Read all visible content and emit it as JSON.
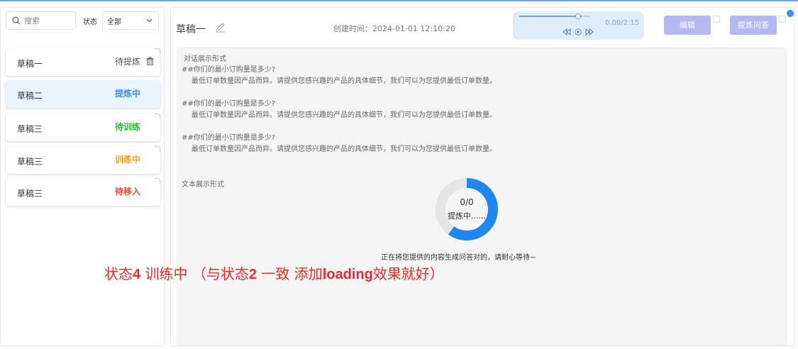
{
  "search": {
    "placeholder": "搜索"
  },
  "status_filter": {
    "label": "状态",
    "value": "全部"
  },
  "drafts": [
    {
      "name": "草稿一",
      "status": "待提炼",
      "status_color": "#555555"
    },
    {
      "name": "草稿二",
      "status": "提炼中",
      "status_color": "#3a8ee6"
    },
    {
      "name": "草稿三",
      "status": "待训练",
      "status_color": "#2eb82e"
    },
    {
      "name": "草稿三",
      "status": "训练中",
      "status_color": "#f2a31a"
    },
    {
      "name": "草稿三",
      "status": "待移入",
      "status_color": "#ee4c3c"
    }
  ],
  "header": {
    "title": "草稿一",
    "created_label": "创建时间：2024-01-01 12:10:20"
  },
  "player": {
    "time": "0.00/2:15",
    "progress": 0.88
  },
  "actions": {
    "edit_label": "编辑",
    "refine_label": "提炼问答"
  },
  "content": {
    "dialog_section_title": "对话展示形式",
    "qa_pairs": [
      {
        "q": "##你们的最小订购量是多少?",
        "a": "最低订单数量因产品而异。请提供您感兴趣的产品的具体细节，我们可以为您提供最低订单数量。"
      },
      {
        "q": "##你们的最小订购量是多少?",
        "a": "最低订单数量因产品而异。请提供您感兴趣的产品的具体细节，我们可以为您提供最低订单数量。"
      },
      {
        "q": "##你们的最小订购量是多少?",
        "a": "最低订单数量因产品而异。请提供您感兴趣的产品的具体细节，我们可以为您提供最低订单数量。"
      }
    ],
    "text_section_title": "文本展示形式",
    "loading": {
      "count": "0/0",
      "label": "提炼中......",
      "message": "正在将您提供的内容生成问答对的，请耐心等待~",
      "progress": 0.6
    }
  },
  "annotation": {
    "p1": "状态",
    "p2": "4",
    "p3": " 训练中 （与状态",
    "p4": "2",
    "p5": " 一致 添加",
    "p6": "loading",
    "p7": "效果就好）"
  },
  "colors": {
    "accent": "#1e88f0",
    "button": "#b3b8f2",
    "annotation": "#ec2a2a"
  }
}
